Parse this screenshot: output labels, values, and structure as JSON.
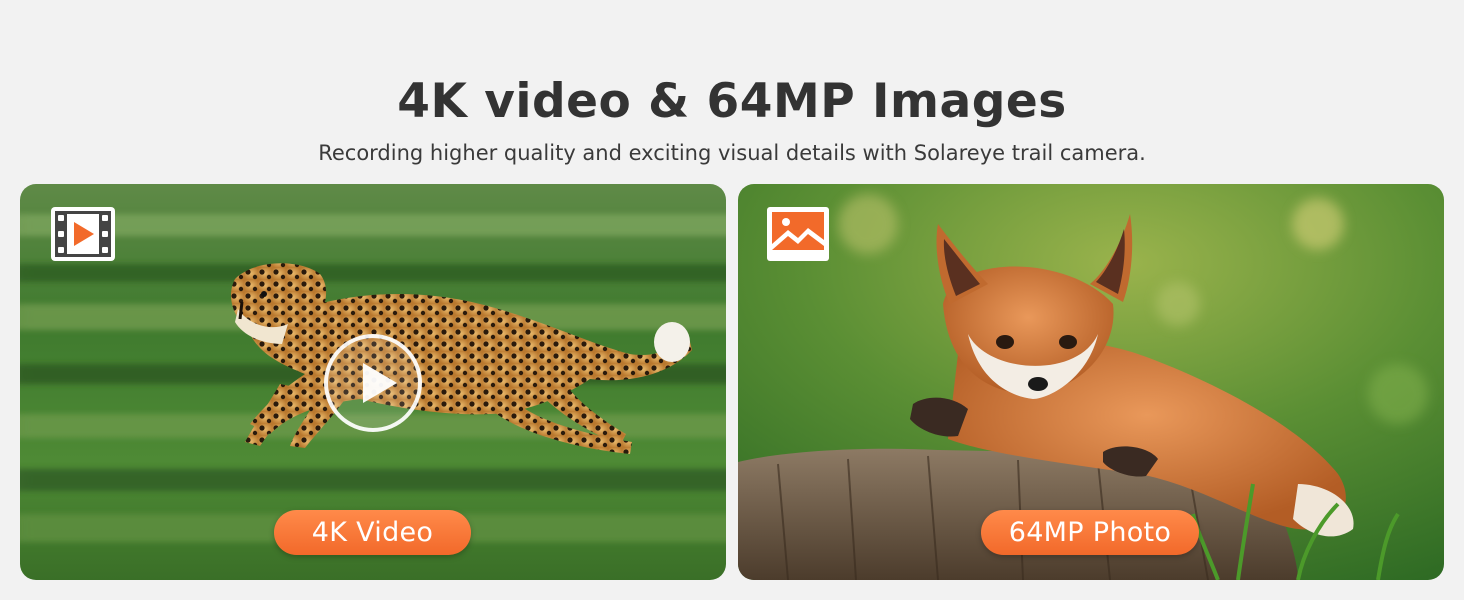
{
  "header": {
    "title": "4K video & 64MP Images",
    "subtitle": "Recording higher quality and exciting visual details with Solareye trail camera."
  },
  "cards": [
    {
      "id": "video",
      "label": "4K Video",
      "icon": "film-strip-play-icon",
      "subject": "cheetah running",
      "overlay": "play-button"
    },
    {
      "id": "photo",
      "label": "64MP Photo",
      "icon": "landscape-image-icon",
      "subject": "fox kit on tree stump"
    }
  ],
  "colors": {
    "background": "#f2f2f2",
    "accent": "#f27a3a",
    "title": "#333333"
  }
}
